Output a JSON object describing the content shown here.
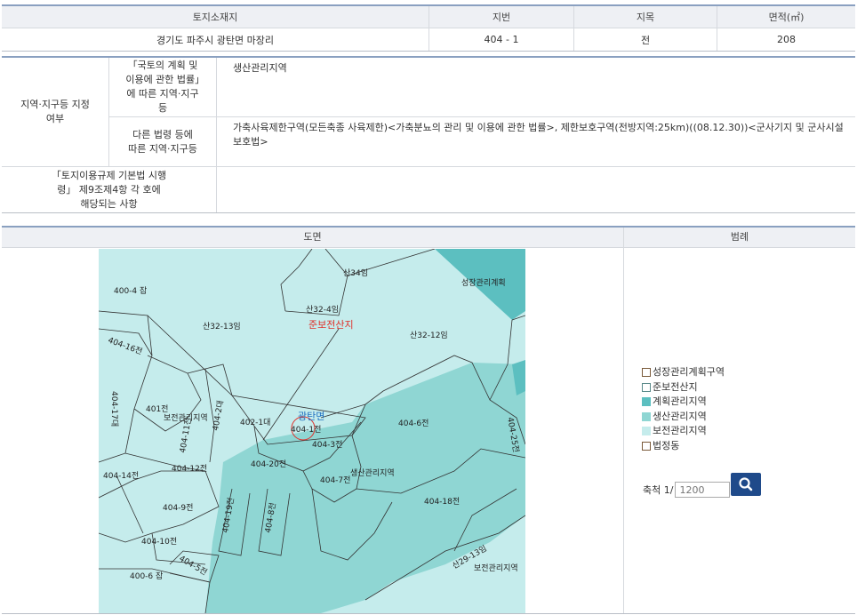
{
  "info_table": {
    "headers": {
      "location": "토지소재지",
      "lot": "지번",
      "category": "지목",
      "area": "면적(㎡)"
    },
    "row": {
      "location": "경기도 파주시 광탄면 마장리",
      "lot": "404 - 1",
      "category": "전",
      "area": "208"
    }
  },
  "zoning": {
    "group_label": "지역·지구등 지정여부",
    "national_label": "「국토의 계획 및 이용에 관한 법률」에 따른 지역·지구등",
    "national_value": "생산관리지역",
    "other_label": "다른 법령 등에 따른 지역·지구등",
    "other_value": "가축사육제한구역(모든축종 사육제한)<가축분뇨의 관리 및 이용에 관한 법률>, 제한보호구역(전방지역:25km)((08.12.30))<군사기지 및 군사시설 보호법>",
    "decree_label": "「토지이용규제 기본법 시행령」 제9조제4항 각 호에 해당되는 사항",
    "decree_value": ""
  },
  "map_section": {
    "map_header": "도면",
    "legend_header": "범례",
    "labels": [
      "400-4 잡",
      "산34임",
      "산32-4임",
      "준보전산지",
      "산32-13임",
      "산32-12임",
      "404-16전",
      "401전",
      "보전관리지역",
      "402-1대",
      "광탄면",
      "404-1전",
      "404-3전",
      "404-6전",
      "404-20전",
      "404-7전",
      "생산관리지역",
      "404-18전",
      "404-12전",
      "404-14전",
      "404-9전",
      "404-10전",
      "404-5전",
      "400-6 잡",
      "성장관리계획",
      "산29-13임",
      "보전관리지역",
      "404-17대",
      "404-11전",
      "404-2대",
      "404-19전",
      "404-8전",
      "404-25전"
    ]
  },
  "legend": [
    {
      "label": "성장관리계획구역",
      "color": "#ffffff"
    },
    {
      "label": "준보전산지",
      "color": "#ffffff"
    },
    {
      "label": "계획관리지역",
      "color": "#5cbfc0"
    },
    {
      "label": "생산관리지역",
      "color": "#8fd6d3"
    },
    {
      "label": "보전관리지역",
      "color": "#c5ecec"
    },
    {
      "label": "법정동",
      "color": "#ffffff"
    }
  ],
  "scale": {
    "label": "축척 1/",
    "placeholder": "1200"
  },
  "colors": {
    "conserve": "#c5ecec",
    "produce": "#8fd6d3",
    "plan": "#5cbfc0",
    "accent": "#1f4a8a",
    "highlight": "#e0302a"
  }
}
